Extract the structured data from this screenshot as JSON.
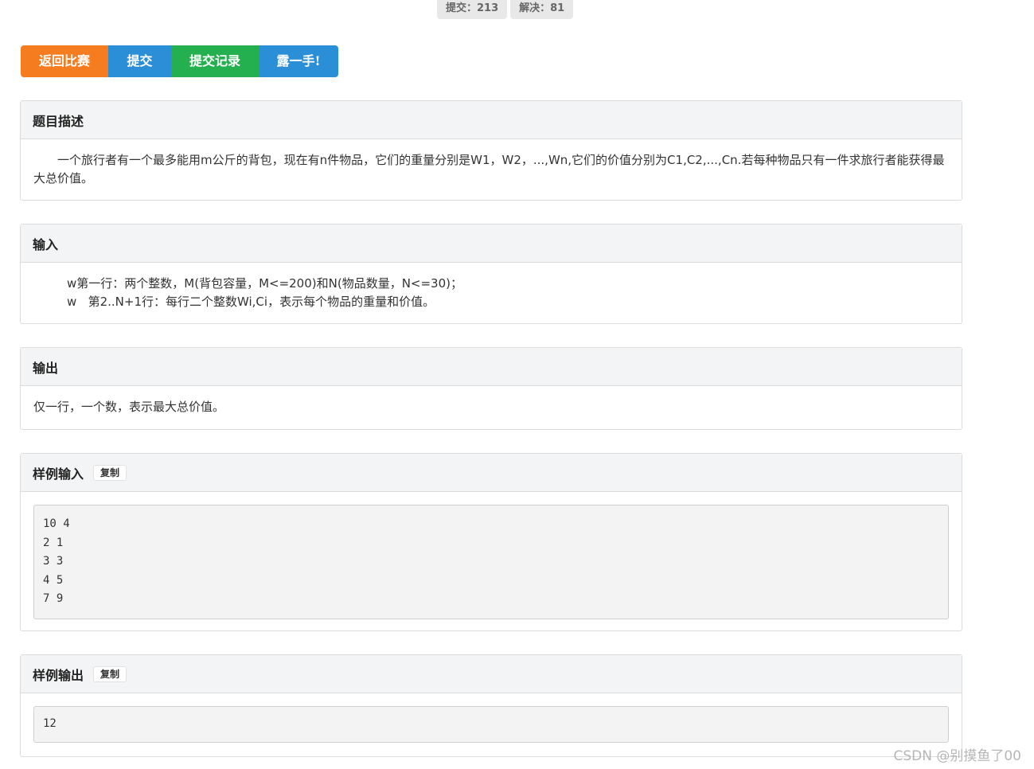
{
  "stats": {
    "submit": "提交：213",
    "solved": "解决：81"
  },
  "actions": {
    "back": "返回比赛",
    "submit": "提交",
    "records": "提交记录",
    "show": "露一手!"
  },
  "description": {
    "title": "题目描述",
    "text": "一个旅行者有一个最多能用m公斤的背包，现在有n件物品，它们的重量分别是W1，W2，...,Wn,它们的价值分别为C1,C2,...,Cn.若每种物品只有一件求旅行者能获得最大总价值。"
  },
  "input": {
    "title": "输入",
    "lines": [
      "w第一行：两个整数，M(背包容量，M<=200)和N(物品数量，N<=30)；",
      "w   第2..N+1行：每行二个整数Wi,Ci，表示每个物品的重量和价值。"
    ]
  },
  "output": {
    "title": "输出",
    "text": "仅一行，一个数，表示最大总价值。"
  },
  "sample_input": {
    "title": "样例输入",
    "copy": "复制",
    "lines": [
      "10 4",
      "2 1",
      "3 3",
      "4 5",
      "7 9"
    ]
  },
  "sample_output": {
    "title": "样例输出",
    "copy": "复制",
    "lines": [
      "12"
    ]
  },
  "watermark": "CSDN @别摸鱼了00"
}
